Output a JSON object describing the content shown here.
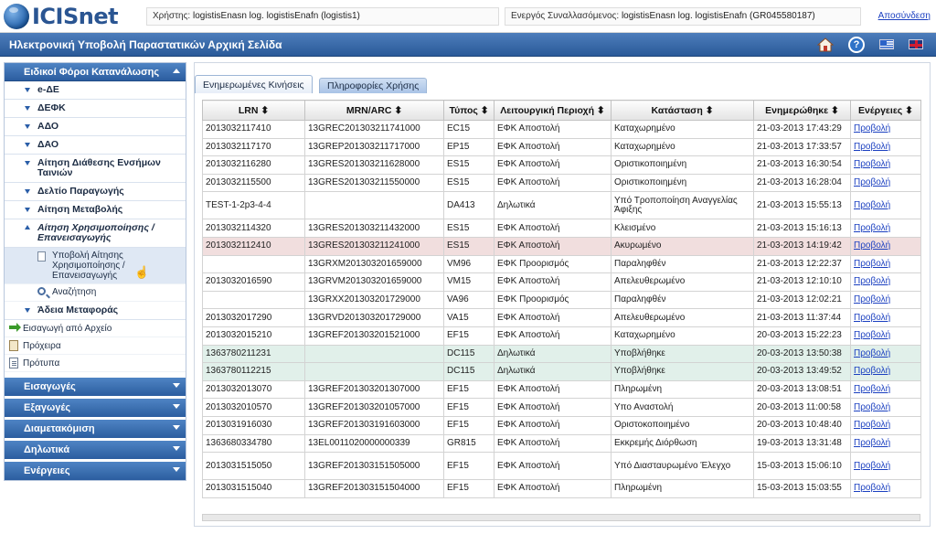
{
  "header": {
    "logo_text": "ICISnet",
    "user_label": "Χρήστης:",
    "user_value": "logistisEnasn log. logistisEnafn (logistis1)",
    "trader_label": "Ενεργός Συναλλασόμενος:",
    "trader_value": "logistisEnasn log. logistisEnafn (GR045580187)",
    "logout": "Αποσύνδεση"
  },
  "titlebar": {
    "title": "Ηλεκτρονική Υποβολή Παραστατικών Αρχική Σελίδα"
  },
  "sidebar": {
    "section_title": "Ειδικοί Φόροι Κατανάλωσης",
    "items": [
      {
        "label": "e-ΔΕ"
      },
      {
        "label": "ΔΕΦΚ"
      },
      {
        "label": "ΑΔΟ"
      },
      {
        "label": "ΔΑΟ"
      },
      {
        "label": "Αίτηση Διάθεσης Ενσήμων Ταινιών"
      },
      {
        "label": "Δελτίο Παραγωγής"
      },
      {
        "label": "Αίτηση Μεταβολής"
      },
      {
        "label": "Αίτηση Χρησιμοποίησης / Επανεισαγωγής"
      }
    ],
    "subitems": [
      {
        "label": "Υποβολή Αίτησης Χρησιμοποίησης / Επανεισαγωγής"
      },
      {
        "label": "Αναζήτηση"
      }
    ],
    "item_after": {
      "label": "Άδεια Μεταφοράς"
    },
    "tools": [
      {
        "label": "Εισαγωγή από Αρχείο"
      },
      {
        "label": "Πρόχειρα"
      },
      {
        "label": "Πρότυπα"
      }
    ],
    "sections": [
      {
        "label": "Εισαγωγές"
      },
      {
        "label": "Εξαγωγές"
      },
      {
        "label": "Διαμετακόμιση"
      },
      {
        "label": "Δηλωτικά"
      },
      {
        "label": "Ενέργειες"
      }
    ]
  },
  "tabs": [
    {
      "label": "Ενημερωμένες Κινήσεις"
    },
    {
      "label": "Πληροφορίες Χρήσης"
    }
  ],
  "table": {
    "headers": [
      "LRN ⬍",
      "MRN/ARC ⬍",
      "Τύπος ⬍",
      "Λειτουργική Περιοχή ⬍",
      "Κατάσταση ⬍",
      "Ενημερώθηκε ⬍",
      "Ενέργειες ⬍"
    ],
    "rows": [
      {
        "lrn": "2013032117410",
        "mrn": "13GREC201303211741000",
        "type": "EC15",
        "area": "ΕΦΚ Αποστολή",
        "status": "Καταχωρημένο",
        "updated": "21-03-2013 17:43:29",
        "action": "Προβολή"
      },
      {
        "lrn": "2013032117170",
        "mrn": "13GREP201303211717000",
        "type": "EP15",
        "area": "ΕΦΚ Αποστολή",
        "status": "Καταχωρημένο",
        "updated": "21-03-2013 17:33:57",
        "action": "Προβολή"
      },
      {
        "lrn": "2013032116280",
        "mrn": "13GRES201303211628000",
        "type": "ES15",
        "area": "ΕΦΚ Αποστολή",
        "status": "Οριστικοποιημένη",
        "updated": "21-03-2013 16:30:54",
        "action": "Προβολή"
      },
      {
        "lrn": "2013032115500",
        "mrn": "13GRES201303211550000",
        "type": "ES15",
        "area": "ΕΦΚ Αποστολή",
        "status": "Οριστικοποιημένη",
        "updated": "21-03-2013 16:28:04",
        "action": "Προβολή"
      },
      {
        "lrn": "TEST-1-2p3-4-4",
        "mrn": "",
        "type": "DA413",
        "area": "Δηλωτικά",
        "status": "Υπό Τροποποίηση Αναγγελίας Άφιξης",
        "updated": "21-03-2013 15:55:13",
        "action": "Προβολή",
        "tall": true
      },
      {
        "lrn": "2013032114320",
        "mrn": "13GRES201303211432000",
        "type": "ES15",
        "area": "ΕΦΚ Αποστολή",
        "status": "Κλεισμένο",
        "updated": "21-03-2013 15:16:13",
        "action": "Προβολή"
      },
      {
        "lrn": "2013032112410",
        "mrn": "13GRES201303211241000",
        "type": "ES15",
        "area": "ΕΦΚ Αποστολή",
        "status": "Ακυρωμένο",
        "updated": "21-03-2013 14:19:42",
        "action": "Προβολή",
        "highlight": "cancel"
      },
      {
        "lrn": "",
        "mrn": "13GRXM201303201659000",
        "type": "VM96",
        "area": "ΕΦΚ Προορισμός",
        "status": "Παραληφθέν",
        "updated": "21-03-2013 12:22:37",
        "action": "Προβολή"
      },
      {
        "lrn": "2013032016590",
        "mrn": "13GRVM201303201659000",
        "type": "VM15",
        "area": "ΕΦΚ Αποστολή",
        "status": "Απελευθερωμένο",
        "updated": "21-03-2013 12:10:10",
        "action": "Προβολή"
      },
      {
        "lrn": "",
        "mrn": "13GRXX201303201729000",
        "type": "VA96",
        "area": "ΕΦΚ Προορισμός",
        "status": "Παραληφθέν",
        "updated": "21-03-2013 12:02:21",
        "action": "Προβολή"
      },
      {
        "lrn": "2013032017290",
        "mrn": "13GRVD201303201729000",
        "type": "VA15",
        "area": "ΕΦΚ Αποστολή",
        "status": "Απελευθερωμένο",
        "updated": "21-03-2013 11:37:44",
        "action": "Προβολή"
      },
      {
        "lrn": "2013032015210",
        "mrn": "13GREF201303201521000",
        "type": "EF15",
        "area": "ΕΦΚ Αποστολή",
        "status": "Καταχωρημένο",
        "updated": "20-03-2013 15:22:23",
        "action": "Προβολή"
      },
      {
        "lrn": "1363780211231",
        "mrn": "",
        "type": "DC115",
        "area": "Δηλωτικά",
        "status": "Υποβλήθηκε",
        "updated": "20-03-2013 13:50:38",
        "action": "Προβολή",
        "highlight": "submitted"
      },
      {
        "lrn": "1363780112215",
        "mrn": "",
        "type": "DC115",
        "area": "Δηλωτικά",
        "status": "Υποβλήθηκε",
        "updated": "20-03-2013 13:49:52",
        "action": "Προβολή",
        "highlight": "submitted"
      },
      {
        "lrn": "2013032013070",
        "mrn": "13GREF201303201307000",
        "type": "EF15",
        "area": "ΕΦΚ Αποστολή",
        "status": "Πληρωμένη",
        "updated": "20-03-2013 13:08:51",
        "action": "Προβολή"
      },
      {
        "lrn": "2013032010570",
        "mrn": "13GREF201303201057000",
        "type": "EF15",
        "area": "ΕΦΚ Αποστολή",
        "status": "Υπο Αναστολή",
        "updated": "20-03-2013 11:00:58",
        "action": "Προβολή"
      },
      {
        "lrn": "2013031916030",
        "mrn": "13GREF201303191603000",
        "type": "EF15",
        "area": "ΕΦΚ Αποστολή",
        "status": "Οριστοκοποιημένο",
        "updated": "20-03-2013 10:48:40",
        "action": "Προβολή"
      },
      {
        "lrn": "1363680334780",
        "mrn": "13EL0011020000000339",
        "type": "GR815",
        "area": "ΕΦΚ Αποστολή",
        "status": "Εκκρεμής Διόρθωση",
        "updated": "19-03-2013 13:31:48",
        "action": "Προβολή"
      },
      {
        "lrn": "2013031515050",
        "mrn": "13GREF201303151505000",
        "type": "EF15",
        "area": "ΕΦΚ Αποστολή",
        "status": "Υπό Διασταυρωμένο Έλεγχο",
        "updated": "15-03-2013 15:06:10",
        "action": "Προβολή",
        "tall": true
      },
      {
        "lrn": "2013031515040",
        "mrn": "13GREF201303151504000",
        "type": "EF15",
        "area": "ΕΦΚ Αποστολή",
        "status": "Πληρωμένη",
        "updated": "15-03-2013 15:03:55",
        "action": "Προβολή"
      }
    ]
  },
  "colors": {
    "title_bar": "#2a5a99",
    "sidebar_header": "#2b5d9f",
    "link": "#1a3fc0",
    "row_cancelled": "#f1dede",
    "row_submitted": "#e1f0ea"
  },
  "icons": [
    "globe-logo-icon",
    "home-icon",
    "help-icon",
    "greek-flag-icon",
    "uk-flag-icon",
    "document-icon",
    "magnifier-icon",
    "pointer-cursor-icon",
    "import-arrow-icon",
    "draft-icon",
    "template-icon"
  ]
}
